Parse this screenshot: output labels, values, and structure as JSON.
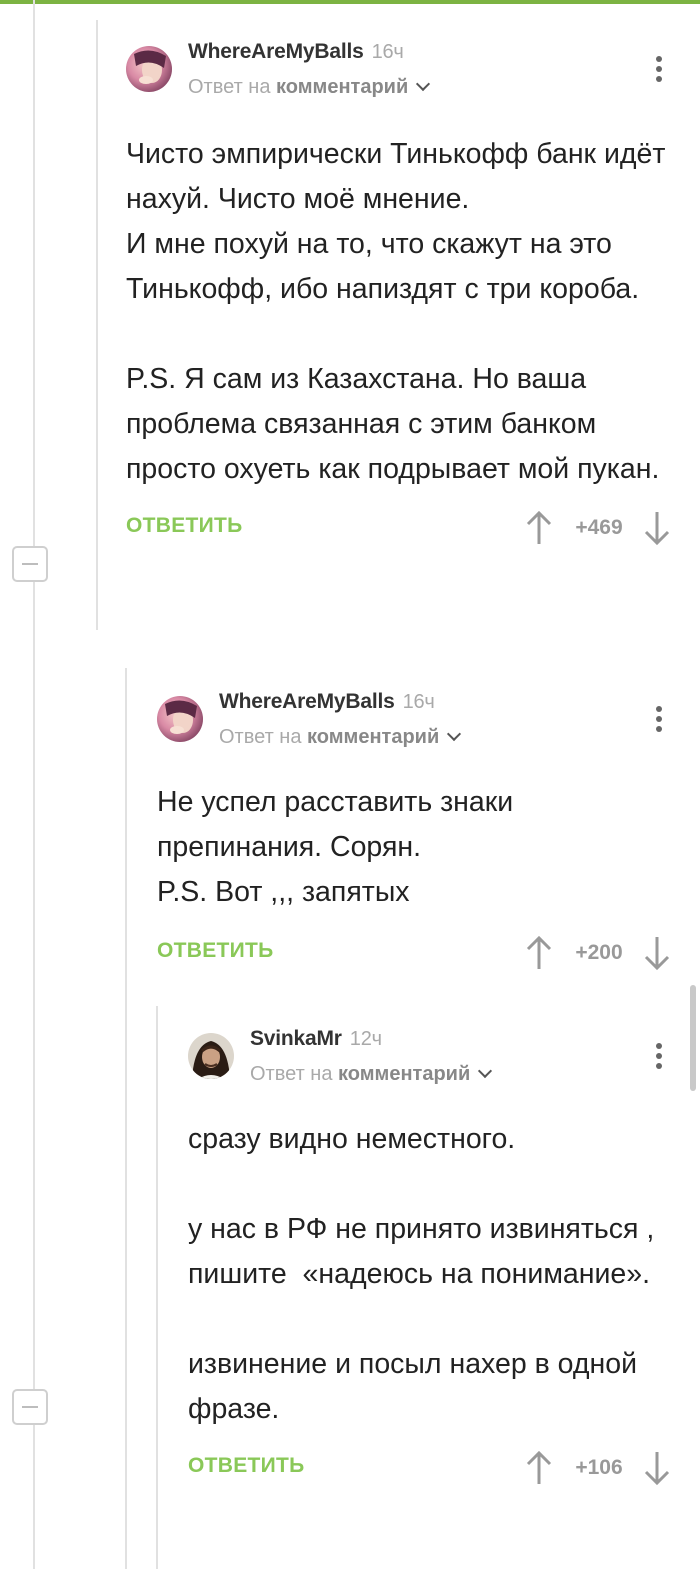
{
  "colors": {
    "accent_green": "#8ac858",
    "top_bar": "#7cb342"
  },
  "collapse_icon": "minus-icon",
  "comments": [
    {
      "author": "WhereAreMyBalls",
      "time": "16ч",
      "reply_prefix": "Ответ на",
      "reply_target": "комментарий",
      "paragraphs": [
        "Чисто эмпирически Тинькофф банк идёт нахуй. Чисто моё мнение.\nИ мне похуй на то, что скажут на это Тинькофф, ибо напиздят с три короба.",
        "P.S. Я сам из Казахстана. Но ваша проблема связанная с этим банком просто охуеть как подрывает мой пукан."
      ],
      "reply_label": "ОТВЕТИТЬ",
      "score": "+469"
    },
    {
      "author": "WhereAreMyBalls",
      "time": "16ч",
      "reply_prefix": "Ответ на",
      "reply_target": "комментарий",
      "paragraphs": [
        "Не успел расставить знаки препинания. Сорян.\nP.S. Вот ,,, запятых"
      ],
      "reply_label": "ОТВЕТИТЬ",
      "score": "+200"
    },
    {
      "author": "SvinkaMr",
      "time": "12ч",
      "reply_prefix": "Ответ на",
      "reply_target": "комментарий",
      "paragraphs": [
        "сразу видно неместного.",
        "у нас в РФ не принято извиняться , пишите  «надеюсь на понимание».",
        "извинение и посыл нахер в одной фразе."
      ],
      "reply_label": "ОТВЕТИТЬ",
      "score": "+106"
    }
  ]
}
